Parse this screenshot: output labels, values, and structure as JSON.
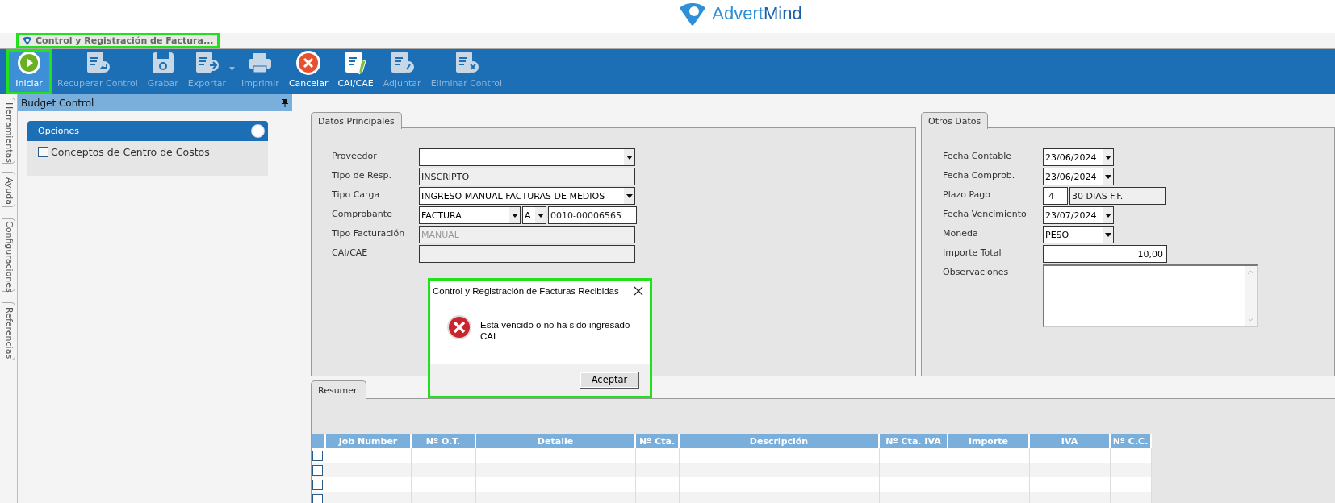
{
  "logo": {
    "parts": [
      "Advert",
      "Mind"
    ]
  },
  "document_tab": {
    "title": "Control y Registración de Factura...",
    "highlighted": true
  },
  "toolbar": [
    {
      "label": "Iniciar",
      "disabled": false,
      "selected": true,
      "highlighted": true
    },
    {
      "label": "Recuperar Control",
      "disabled": true,
      "selected": false,
      "highlighted": false
    },
    {
      "label": "Grabar",
      "disabled": true,
      "selected": false,
      "highlighted": false
    },
    {
      "label": "Exportar",
      "disabled": true,
      "selected": false,
      "highlighted": false
    },
    {
      "label": "Imprimir",
      "disabled": true,
      "selected": false,
      "highlighted": false
    },
    {
      "label": "Cancelar",
      "disabled": false,
      "selected": false,
      "highlighted": false
    },
    {
      "label": "CAI/CAE",
      "disabled": false,
      "selected": false,
      "highlighted": false
    },
    {
      "label": "Adjuntar",
      "disabled": true,
      "selected": false,
      "highlighted": false
    },
    {
      "label": "Eliminar Control",
      "disabled": true,
      "selected": false,
      "highlighted": false
    }
  ],
  "side_tabs": [
    "Herramientas",
    "Ayuda",
    "Configuraciones",
    "Referencias"
  ],
  "side_panel": {
    "title": "Budget Control",
    "section": {
      "title": "Opciones",
      "options": [
        {
          "label": "Conceptos de Centro de Costos",
          "checked": false
        }
      ]
    }
  },
  "datos_principales": {
    "tab": "Datos Principales",
    "rows": [
      {
        "label": "Proveedor",
        "fields": [
          {
            "kind": "combo"
          }
        ]
      },
      {
        "label": "Tipo de Resp.",
        "fields": [
          {
            "kind": "readonly",
            "value": "INSCRIPTO"
          }
        ]
      },
      {
        "label": "Tipo Carga",
        "fields": [
          {
            "kind": "combo",
            "value": "INGRESO MANUAL FACTURAS DE MEDIOS"
          }
        ]
      },
      {
        "label": "Comprobante",
        "fields": [
          {
            "kind": "combo",
            "value": "FACTURA"
          },
          {
            "kind": "combo",
            "value": "A"
          },
          {
            "kind": "text",
            "value": "0010-00006565"
          }
        ]
      },
      {
        "label": "Tipo Facturación",
        "fields": [
          {
            "kind": "disabled",
            "value": "MANUAL"
          }
        ]
      },
      {
        "label": "CAI/CAE",
        "fields": [
          {
            "kind": "readonly"
          }
        ]
      }
    ]
  },
  "otros_datos": {
    "tab": "Otros Datos",
    "rows": [
      {
        "label": "Fecha Contable",
        "fields": [
          {
            "kind": "combo",
            "value": "23/06/2024"
          }
        ]
      },
      {
        "label": "Fecha Comprob.",
        "fields": [
          {
            "kind": "combo",
            "value": "23/06/2024"
          }
        ]
      },
      {
        "label": "Plazo Pago",
        "fields": [
          {
            "kind": "text",
            "value": "-4"
          },
          {
            "kind": "readonly",
            "value": "30 DIAS F.F."
          }
        ]
      },
      {
        "label": "Fecha Vencimiento",
        "fields": [
          {
            "kind": "combo",
            "value": "23/07/2024"
          }
        ]
      },
      {
        "label": "Moneda",
        "fields": [
          {
            "kind": "combo",
            "value": "PESO"
          }
        ]
      },
      {
        "label": "Importe Total",
        "fields": [
          {
            "kind": "number",
            "value": "10,00"
          }
        ]
      },
      {
        "label": "Observaciones",
        "fields": [
          {
            "kind": "memo"
          }
        ]
      }
    ]
  },
  "resumen": {
    "tab": "Resumen",
    "columns": [
      "Job Number",
      "Nº O.T.",
      "Detalle",
      "Nº Cta.",
      "Descripción",
      "Nº Cta. IVA",
      "Importe",
      "IVA",
      "Nº C.C."
    ],
    "rows": [
      {
        "checked": false
      },
      {
        "checked": false
      },
      {
        "checked": false
      },
      {
        "checked": false
      }
    ]
  },
  "dialog": {
    "title": "Control y Registración de Facturas Recibidas",
    "message": "Está vencido o no ha sido ingresado CAI",
    "button": "Aceptar",
    "highlighted": true
  }
}
